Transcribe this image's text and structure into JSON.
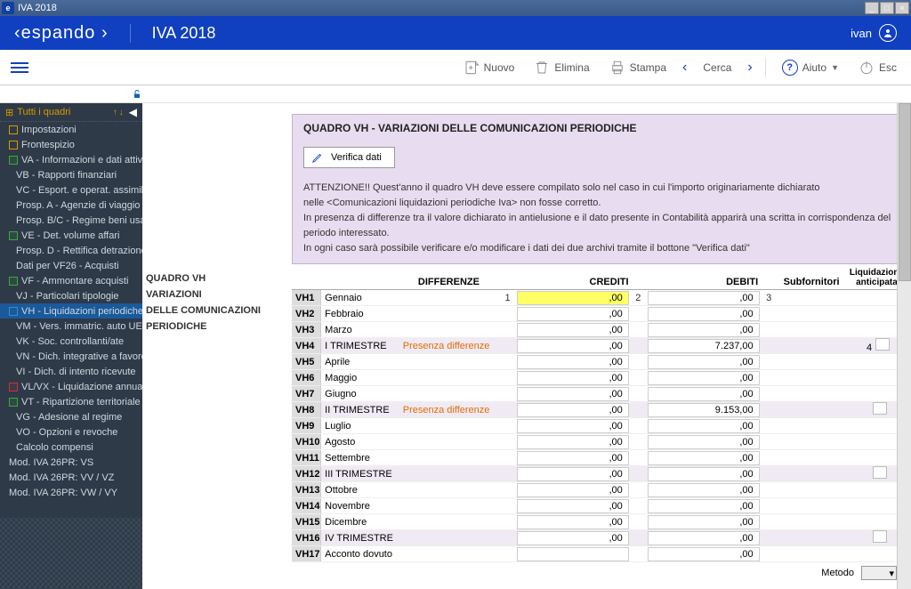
{
  "window": {
    "title": "IVA 2018"
  },
  "header": {
    "logo": "espando",
    "app_title": "IVA 2018",
    "user": "ivan"
  },
  "toolbar": {
    "nuovo": "Nuovo",
    "elimina": "Elimina",
    "stampa": "Stampa",
    "cerca": "Cerca",
    "aiuto": "Aiuto",
    "esc": "Esc"
  },
  "sidebar": {
    "header": "Tutti i quadri",
    "items": [
      {
        "label": "Impostazioni",
        "chk": "orange",
        "level": 0
      },
      {
        "label": "Frontespizio",
        "chk": "orange",
        "level": 0
      },
      {
        "label": "VA - Informazioni e dati attività",
        "chk": "green",
        "level": 0
      },
      {
        "label": "VB - Rapporti finanziari",
        "chk": "",
        "level": 1
      },
      {
        "label": "VC - Esport. e operat. assimilati",
        "chk": "",
        "level": 1
      },
      {
        "label": "Prosp. A - Agenzie di viaggio",
        "chk": "",
        "level": 1
      },
      {
        "label": "Prosp. B/C - Regime beni usati",
        "chk": "",
        "level": 1
      },
      {
        "label": "VE - Det. volume affari",
        "chk": "green",
        "level": 0
      },
      {
        "label": "Prosp. D - Rettifica detrazione",
        "chk": "",
        "level": 1
      },
      {
        "label": "Dati per VF26 - Acquisti",
        "chk": "",
        "level": 1
      },
      {
        "label": "VF - Ammontare acquisti",
        "chk": "green",
        "level": 0
      },
      {
        "label": "VJ - Particolari tipologie",
        "chk": "",
        "level": 1
      },
      {
        "label": "VH - Liquidazioni periodiche",
        "chk": "blue",
        "level": 0,
        "selected": true
      },
      {
        "label": "VM - Vers. immatric. auto UE",
        "chk": "",
        "level": 1
      },
      {
        "label": "VK - Soc. controllanti/ate",
        "chk": "",
        "level": 1
      },
      {
        "label": "VN - Dich. integrative a favore",
        "chk": "",
        "level": 1
      },
      {
        "label": "VI - Dich. di intento ricevute",
        "chk": "",
        "level": 1
      },
      {
        "label": "VL/VX - Liquidazione annuale",
        "chk": "red",
        "level": 0
      },
      {
        "label": "VT - Ripartizione territoriale",
        "chk": "green",
        "level": 0
      },
      {
        "label": "VG - Adesione al regime",
        "chk": "",
        "level": 1
      },
      {
        "label": "VO - Opzioni e revoche",
        "chk": "",
        "level": 1
      },
      {
        "label": "Calcolo compensi",
        "chk": "",
        "level": 1
      },
      {
        "label": "Mod. IVA 26PR: VS",
        "chk": "",
        "level": 0
      },
      {
        "label": "Mod. IVA 26PR: VV / VZ",
        "chk": "",
        "level": 0
      },
      {
        "label": "Mod. IVA 26PR: VW / VY",
        "chk": "",
        "level": 0
      }
    ]
  },
  "side_labels": {
    "l1": "QUADRO VH",
    "l2": "VARIAZIONI",
    "l3": "DELLE COMUNICAZIONI",
    "l4": "PERIODICHE"
  },
  "form": {
    "title": "QUADRO VH - VARIAZIONI DELLE COMUNICAZIONI PERIODICHE",
    "verify": "Verifica dati",
    "warn1": "ATTENZIONE!! Quest'anno il quadro VH deve essere compilato solo nel caso in cui l'importo originariamente dichiarato",
    "warn2": "nelle <Comunicazioni liquidazioni periodiche Iva> non fosse corretto.",
    "warn3": "In presenza di differenze tra il valore dichiarato in antielusione e il dato presente in Contabilità apparirà una scritta in corrispondenza del periodo interessato.",
    "warn4": "In ogni caso sarà possibile verificare e/o modificare i dati dei due archivi tramite il bottone \"Verifica dati\""
  },
  "grid": {
    "h_differenze": "DIFFERENZE",
    "h_crediti": "CREDITI",
    "h_debiti": "DEBITI",
    "h_subfornitori": "Subfornitori",
    "h_liquidazione": "Liquidazione",
    "h_anticipata": "anticipata",
    "presenza": "Presenza differenze",
    "metodo": "Metodo",
    "rows": [
      {
        "code": "VH1",
        "month": "Gennaio",
        "diff": "",
        "n1": "1",
        "cred": ",00",
        "n2": "2",
        "deb": ",00",
        "n3": "3",
        "q": false,
        "hl": true,
        "liq": ""
      },
      {
        "code": "VH2",
        "month": "Febbraio",
        "diff": "",
        "n1": "",
        "cred": ",00",
        "n2": "",
        "deb": ",00",
        "n3": "",
        "q": false,
        "liq": ""
      },
      {
        "code": "VH3",
        "month": "Marzo",
        "diff": "",
        "n1": "",
        "cred": ",00",
        "n2": "",
        "deb": ",00",
        "n3": "",
        "q": false,
        "liq": ""
      },
      {
        "code": "VH4",
        "month": "I TRIMESTRE",
        "diff": "Presenza differenze",
        "n1": "",
        "cred": ",00",
        "n2": "",
        "deb": "7.237,00",
        "n3": "",
        "q": true,
        "liq": "4"
      },
      {
        "code": "VH5",
        "month": "Aprile",
        "diff": "",
        "n1": "",
        "cred": ",00",
        "n2": "",
        "deb": ",00",
        "n3": "",
        "q": false,
        "liq": ""
      },
      {
        "code": "VH6",
        "month": "Maggio",
        "diff": "",
        "n1": "",
        "cred": ",00",
        "n2": "",
        "deb": ",00",
        "n3": "",
        "q": false,
        "liq": ""
      },
      {
        "code": "VH7",
        "month": "Giugno",
        "diff": "",
        "n1": "",
        "cred": ",00",
        "n2": "",
        "deb": ",00",
        "n3": "",
        "q": false,
        "liq": ""
      },
      {
        "code": "VH8",
        "month": "II TRIMESTRE",
        "diff": "Presenza differenze",
        "n1": "",
        "cred": ",00",
        "n2": "",
        "deb": "9.153,00",
        "n3": "",
        "q": true,
        "liq": ""
      },
      {
        "code": "VH9",
        "month": "Luglio",
        "diff": "",
        "n1": "",
        "cred": ",00",
        "n2": "",
        "deb": ",00",
        "n3": "",
        "q": false,
        "liq": ""
      },
      {
        "code": "VH10",
        "month": "Agosto",
        "diff": "",
        "n1": "",
        "cred": ",00",
        "n2": "",
        "deb": ",00",
        "n3": "",
        "q": false,
        "liq": ""
      },
      {
        "code": "VH11",
        "month": "Settembre",
        "diff": "",
        "n1": "",
        "cred": ",00",
        "n2": "",
        "deb": ",00",
        "n3": "",
        "q": false,
        "liq": ""
      },
      {
        "code": "VH12",
        "month": "III TRIMESTRE",
        "diff": "",
        "n1": "",
        "cred": ",00",
        "n2": "",
        "deb": ",00",
        "n3": "",
        "q": true,
        "liq": ""
      },
      {
        "code": "VH13",
        "month": "Ottobre",
        "diff": "",
        "n1": "",
        "cred": ",00",
        "n2": "",
        "deb": ",00",
        "n3": "",
        "q": false,
        "liq": ""
      },
      {
        "code": "VH14",
        "month": "Novembre",
        "diff": "",
        "n1": "",
        "cred": ",00",
        "n2": "",
        "deb": ",00",
        "n3": "",
        "q": false,
        "liq": ""
      },
      {
        "code": "VH15",
        "month": "Dicembre",
        "diff": "",
        "n1": "",
        "cred": ",00",
        "n2": "",
        "deb": ",00",
        "n3": "",
        "q": false,
        "liq": ""
      },
      {
        "code": "VH16",
        "month": "IV TRIMESTRE",
        "diff": "",
        "n1": "",
        "cred": ",00",
        "n2": "",
        "deb": ",00",
        "n3": "",
        "q": true,
        "liq": ""
      },
      {
        "code": "VH17",
        "month": "Acconto dovuto",
        "diff": "",
        "n1": "",
        "cred": "",
        "n2": "",
        "deb": ",00",
        "n3": "",
        "q": false,
        "liq": "",
        "acconto": true
      }
    ]
  }
}
